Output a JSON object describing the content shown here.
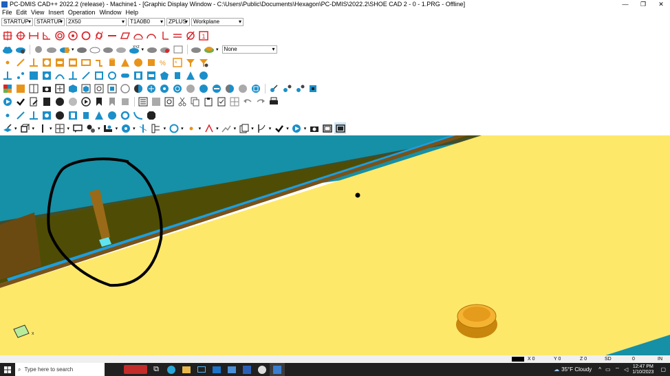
{
  "window": {
    "title": "PC-DMIS CAD++ 2022.2 (release) - Machine1 - [Graphic Display Window - C:\\Users\\Public\\Documents\\Hexagon\\PC-DMIS\\2022.2\\SHOE CAD 2 - 0 - 1.PRG - Offline]",
    "controls": [
      "—",
      "❐",
      "✕"
    ]
  },
  "menu": [
    "File",
    "Edit",
    "View",
    "Insert",
    "Operation",
    "Window",
    "Help"
  ],
  "combos": {
    "c1": "STARTUP",
    "c2": "STARTUP",
    "c3": "2X50",
    "c4": "T1A0B0",
    "c5": "ZPLUS",
    "c6": "Workplane",
    "none": "None"
  },
  "statusbar": {
    "x_label": "X 0",
    "y_label": "Y 0",
    "z_label": "Z 0",
    "sd": "SD",
    "zero": "0",
    "units": "IN"
  },
  "taskbar": {
    "search_placeholder": "Type here to search",
    "weather": "35°F  Cloudy",
    "time": "12:47 PM",
    "date": "1/10/2023"
  },
  "colors": {
    "accent_red": "#d9262b",
    "accent_orange": "#e8941a",
    "accent_blue": "#1b8fc9",
    "viewport_yellow": "#fde86a",
    "viewport_teal": "#1590a6",
    "viewport_olive": "#4f4d05"
  }
}
